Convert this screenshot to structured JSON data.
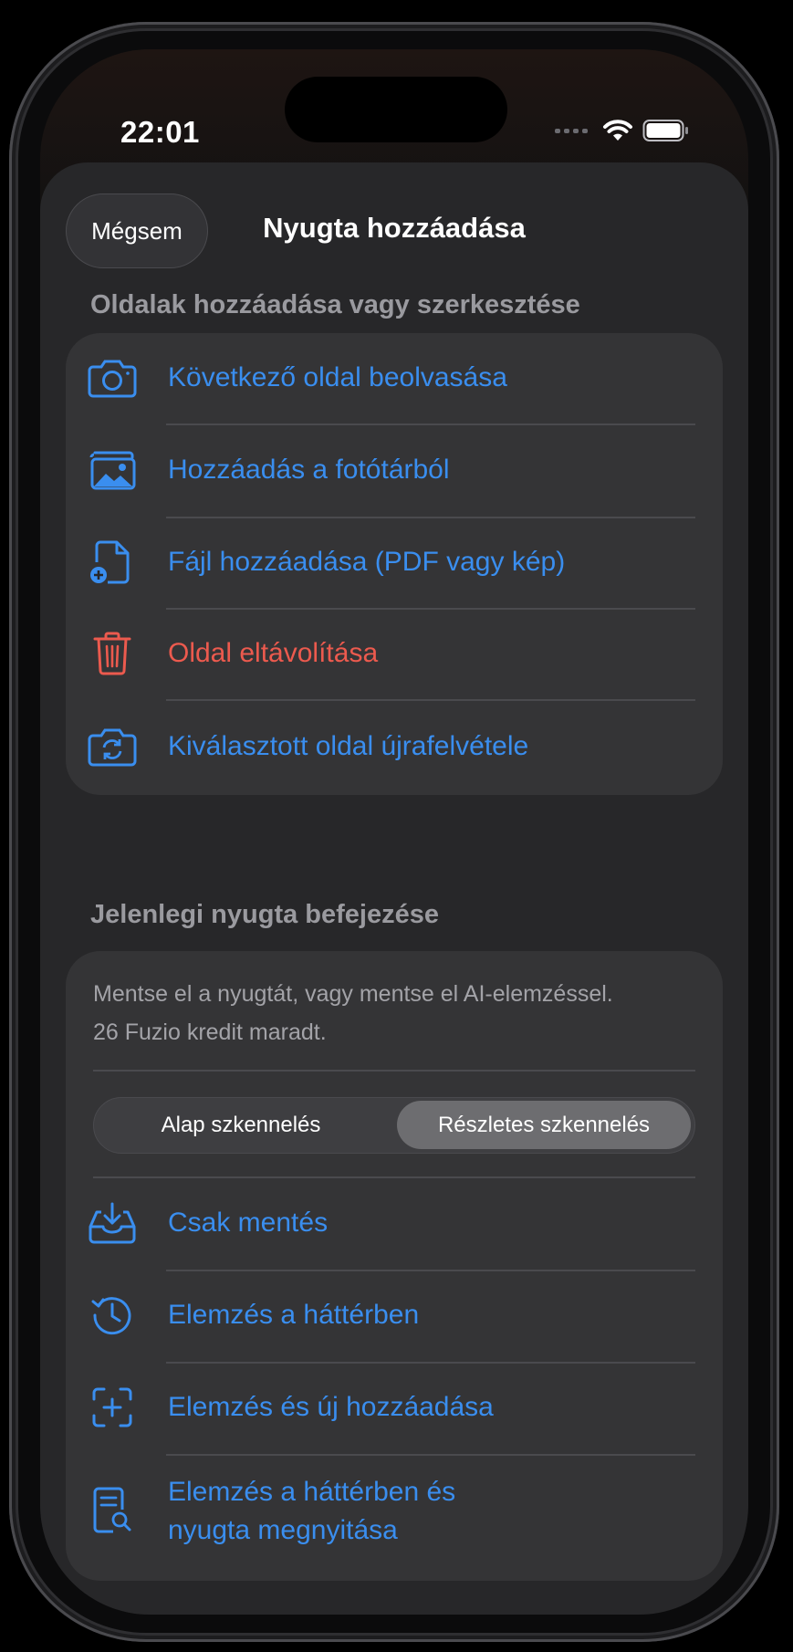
{
  "status_bar": {
    "time": "22:01"
  },
  "sheet": {
    "cancel_label": "Mégsem",
    "title": "Nyugta hozzáadása"
  },
  "pages_section": {
    "header": "Oldalak hozzáadása vagy szerkesztése",
    "items": [
      {
        "label": "Következő oldal beolvasása",
        "icon": "camera-icon"
      },
      {
        "label": "Hozzáadás a fotótárból",
        "icon": "photo-library-icon"
      },
      {
        "label": "Fájl hozzáadása (PDF vagy kép)",
        "icon": "add-file-icon"
      },
      {
        "label": "Oldal eltávolítása",
        "icon": "trash-icon"
      },
      {
        "label": "Kiválasztott oldal újrafelvétele",
        "icon": "retake-camera-icon"
      }
    ]
  },
  "finish_section": {
    "header": "Jelenlegi nyugta befejezése",
    "description_line1": "Mentse el a nyugtát, vagy mentse el AI-elemzéssel.",
    "description_line2": "26 Fuzio kredit maradt.",
    "segments": [
      "Alap szkennelés",
      "Részletes szkennelés"
    ],
    "selected_segment": "Részletes szkennelés",
    "items": [
      {
        "label": "Csak mentés",
        "icon": "tray-download-icon"
      },
      {
        "label": "Elemzés a háttérben",
        "icon": "history-clock-icon"
      },
      {
        "label": "Elemzés és új hozzáadása",
        "icon": "scan-plus-icon"
      },
      {
        "label_line1": "Elemzés a háttérben és",
        "label_line2": "nyugta megnyitása",
        "icon": "document-search-icon"
      }
    ]
  },
  "colors": {
    "accent": "#3a8eef",
    "destructive": "#ec5a4e",
    "sheet_bg": "#272729",
    "card_bg": "#343436"
  }
}
